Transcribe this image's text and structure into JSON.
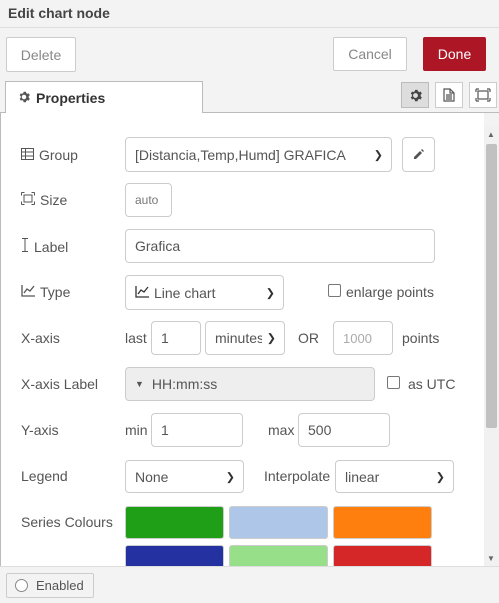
{
  "window": {
    "title": "Edit chart node"
  },
  "toolbar": {
    "delete_label": "Delete",
    "cancel_label": "Cancel",
    "done_label": "Done"
  },
  "tabs": {
    "properties_label": "Properties"
  },
  "form": {
    "group": {
      "label": "Group",
      "value": "[Distancia,Temp,Humd] GRAFICA"
    },
    "size": {
      "label": "Size",
      "value": "auto"
    },
    "label": {
      "label": "Label",
      "value": "Grafica"
    },
    "type": {
      "label": "Type",
      "value": "Line chart",
      "enlarge_label": "enlarge points"
    },
    "xaxis": {
      "label": "X-axis",
      "last_label": "last",
      "last_value": "1",
      "unit_value": "minutes",
      "or_label": "OR",
      "points_placeholder": "1000",
      "points_label": "points"
    },
    "xaxis_label": {
      "label": "X-axis Label",
      "value": "HH:mm:ss",
      "utc_label": "as UTC"
    },
    "yaxis": {
      "label": "Y-axis",
      "min_label": "min",
      "min_value": "1",
      "max_label": "max",
      "max_value": "500"
    },
    "legend": {
      "label": "Legend",
      "value": "None",
      "interpolate_label": "Interpolate",
      "interpolate_value": "linear"
    },
    "series_colours": {
      "label": "Series Colours",
      "colors": [
        "#1f9e17",
        "#aec7e8",
        "#ff7f0e",
        "#2431a0",
        "#98df8a",
        "#d62728"
      ]
    }
  },
  "footer": {
    "enabled_label": "Enabled"
  },
  "theme": {
    "accent": "#ad1625"
  }
}
